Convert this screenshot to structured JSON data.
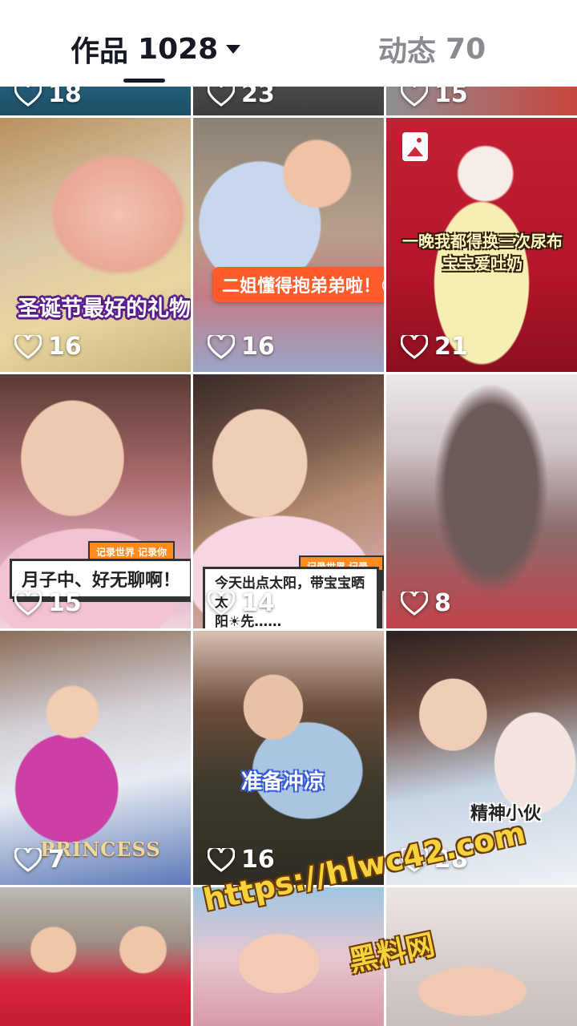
{
  "tabs": {
    "works_label": "作品",
    "works_count": "1028",
    "moments_label": "动态",
    "moments_count": "70"
  },
  "colors": {
    "active": "#161823",
    "inactive": "#8a8b91",
    "like_text": "#ffffff"
  },
  "videos": [
    {
      "likes": "18"
    },
    {
      "likes": "23"
    },
    {
      "likes": "15"
    },
    {
      "likes": "16",
      "caption": "圣诞节最好的礼物"
    },
    {
      "likes": "16",
      "caption": "二姐懂得抱弟弟啦！😊"
    },
    {
      "likes": "21",
      "caption_line1": "一晚我都得换三次尿布",
      "caption_line2": "宝宝爱吐奶",
      "icon": "photo-icon"
    },
    {
      "likes": "15",
      "caption": "月子中、好无聊啊！",
      "tag": "记录世界 记录你"
    },
    {
      "likes": "14",
      "caption_line1": "今天出点太阳，带宝宝晒太",
      "caption_line2": "阳☀先……",
      "tag": "记录世界 记录你"
    },
    {
      "likes": "8"
    },
    {
      "likes": "7",
      "caption": "PRINCESS"
    },
    {
      "likes": "16",
      "caption": "准备冲凉"
    },
    {
      "likes": "28",
      "caption": "精神小伙"
    },
    {},
    {},
    {}
  ],
  "watermark": {
    "url": "https://hlwc42.com",
    "name": "黑料网"
  }
}
